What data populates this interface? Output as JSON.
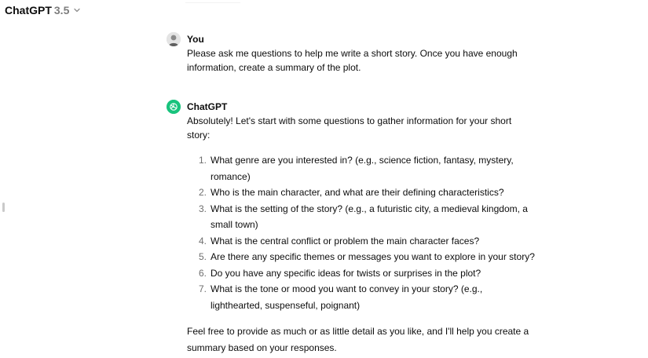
{
  "header": {
    "model_name": "ChatGPT",
    "model_version": "3.5"
  },
  "conversation": {
    "user_message": {
      "author": "You",
      "text": "Please ask me questions to help me write a short story. Once you have enough information, create a summary of the plot."
    },
    "assistant_message": {
      "author": "ChatGPT",
      "intro": "Absolutely! Let's start with some questions to gather information for your short story:",
      "questions": [
        {
          "num": "1.",
          "text": "What genre are you interested in? (e.g., science fiction, fantasy, mystery, romance)"
        },
        {
          "num": "2.",
          "text": "Who is the main character, and what are their defining characteristics?"
        },
        {
          "num": "3.",
          "text": "What is the setting of the story? (e.g., a futuristic city, a medieval kingdom, a small town)"
        },
        {
          "num": "4.",
          "text": "What is the central conflict or problem the main character faces?"
        },
        {
          "num": "5.",
          "text": "Are there any specific themes or messages you want to explore in your story?"
        },
        {
          "num": "6.",
          "text": "Do you have any specific ideas for twists or surprises in the plot?"
        },
        {
          "num": "7.",
          "text": "What is the tone or mood you want to convey in your story? (e.g., lighthearted, suspenseful, poignant)"
        }
      ],
      "closing": "Feel free to provide as much or as little detail as you like, and I'll help you create a summary based on your responses."
    },
    "actions": [
      "copy-icon",
      "thumbs-up-icon",
      "thumbs-down-icon",
      "regenerate-icon"
    ]
  },
  "colors": {
    "assistant_avatar": "#19c37d",
    "muted_text": "#7d7d7d"
  }
}
